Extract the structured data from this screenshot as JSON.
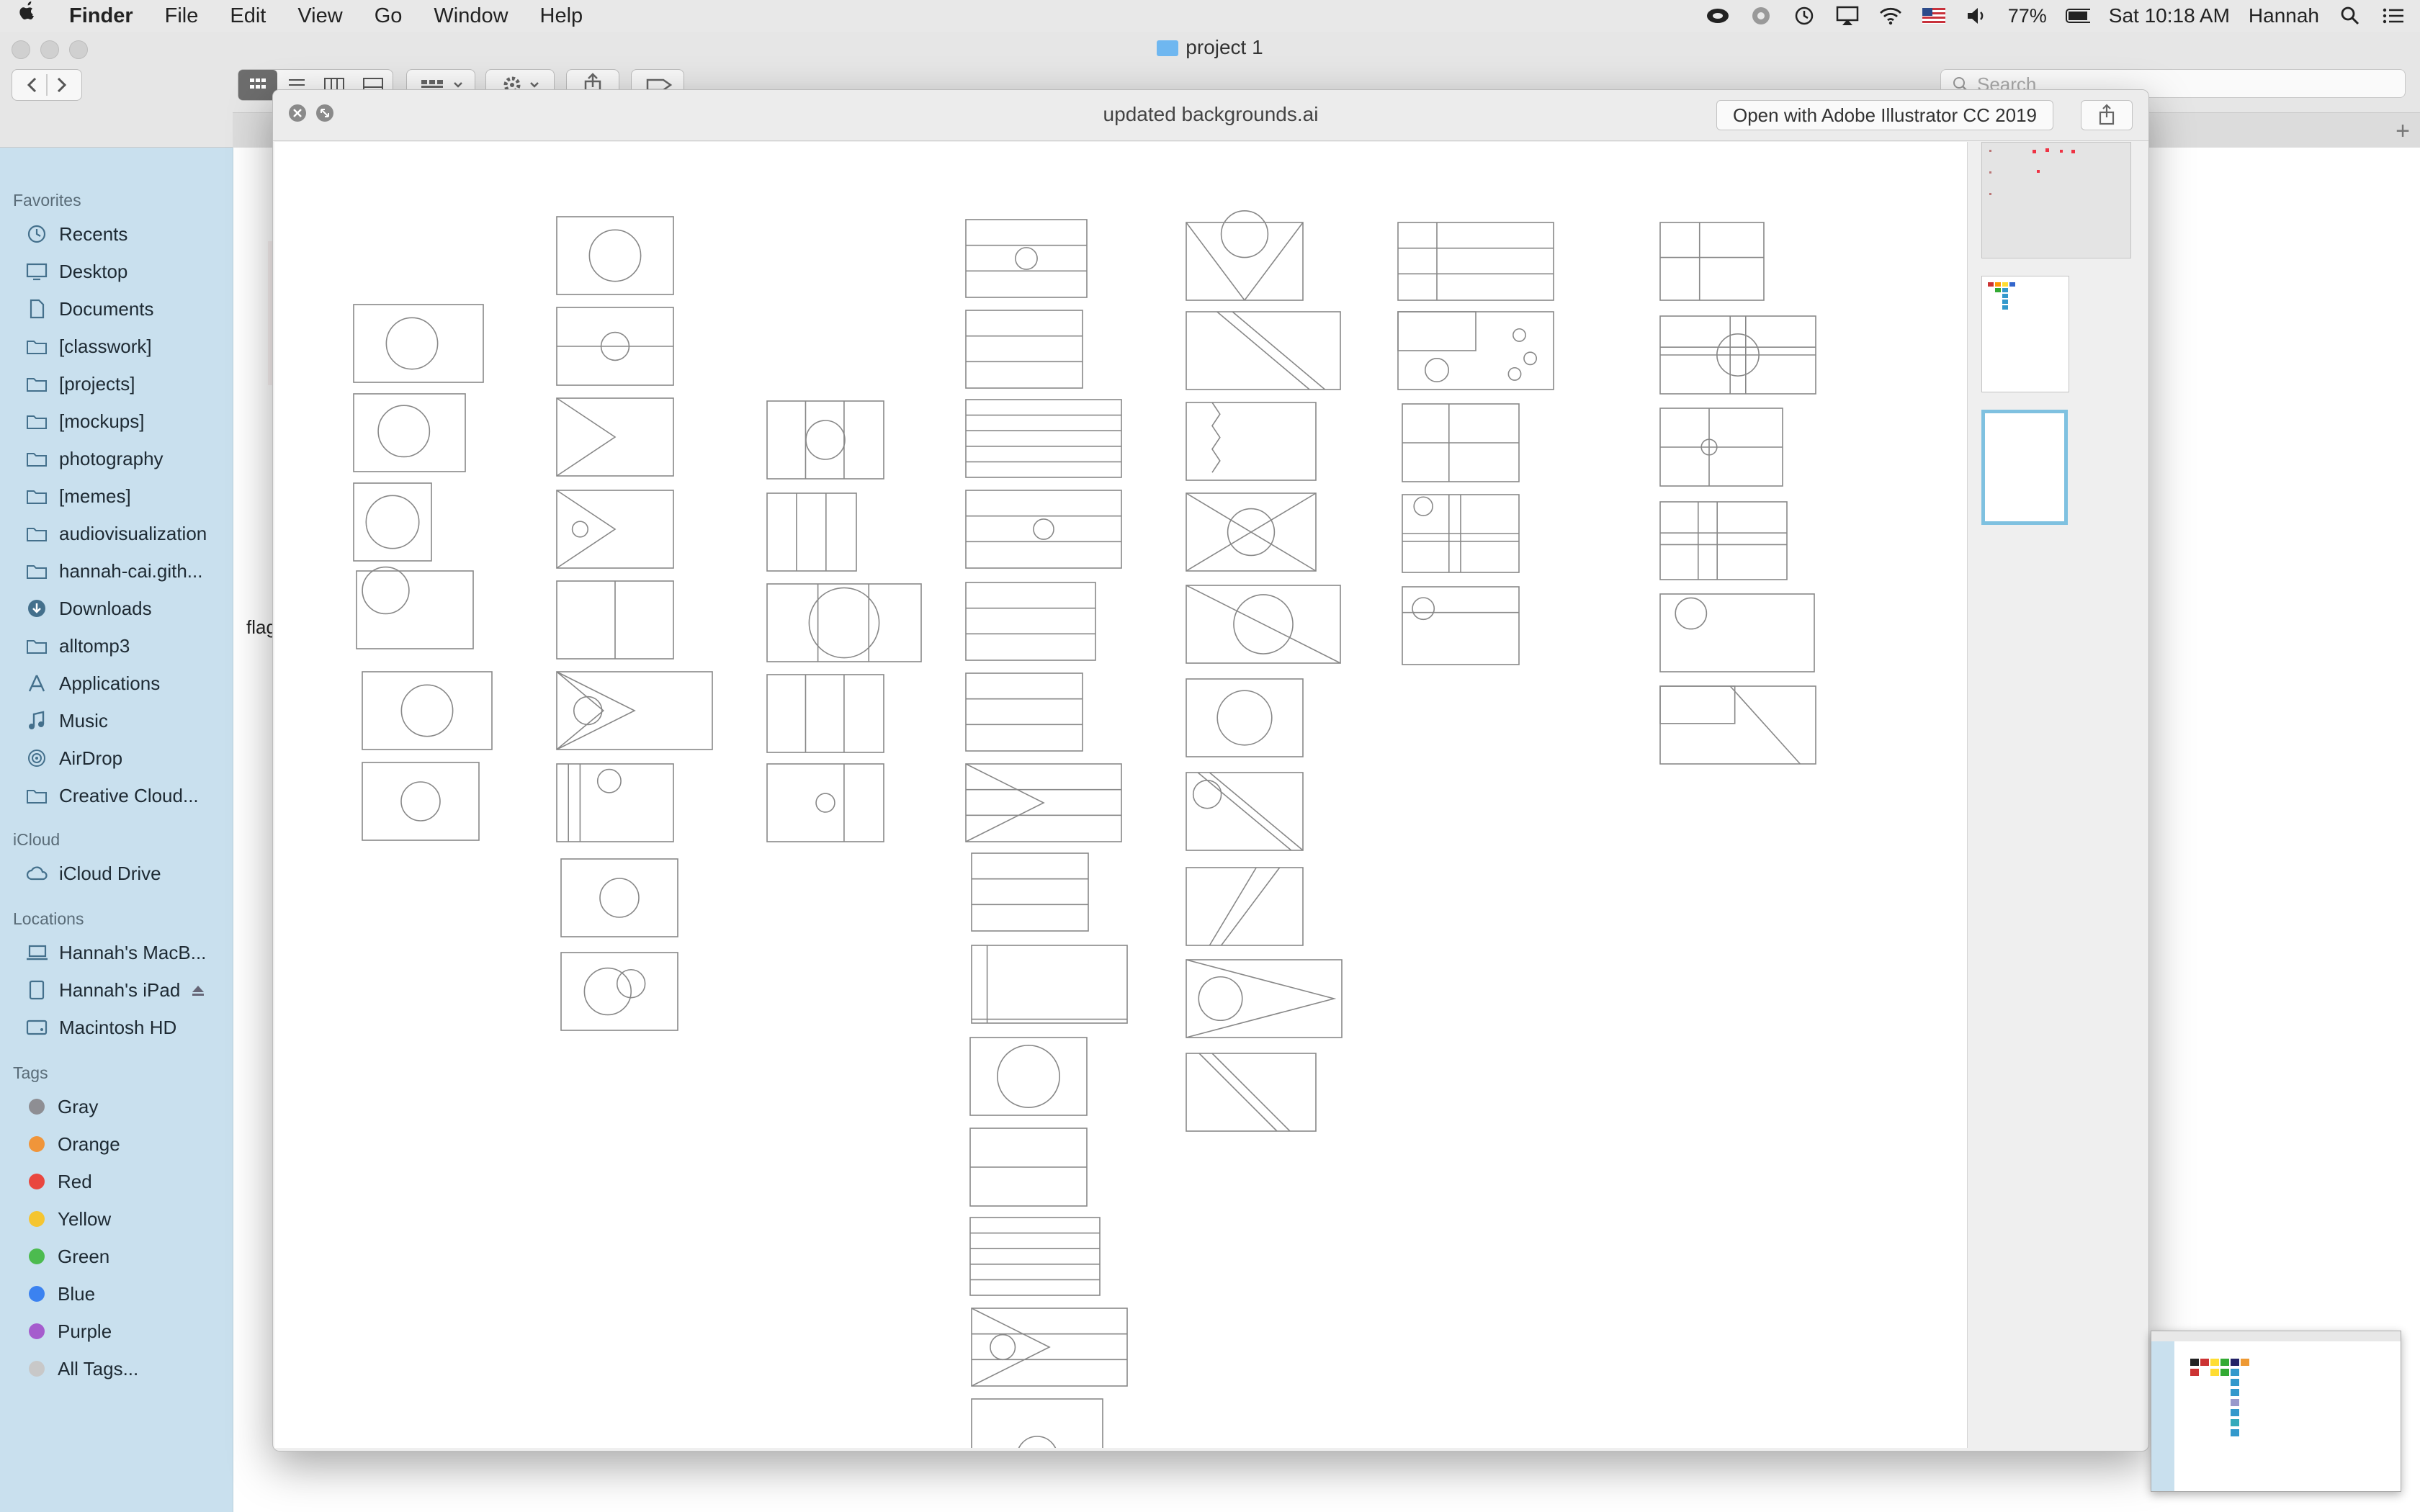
{
  "menubar": {
    "app": "Finder",
    "items": [
      "File",
      "Edit",
      "View",
      "Go",
      "Window",
      "Help"
    ],
    "battery": "77%",
    "clock": "Sat 10:18 AM",
    "user": "Hannah",
    "icons": [
      "apple-icon",
      "creative-cloud-icon",
      "sync-icon",
      "time-machine-icon",
      "airplay-icon",
      "wifi-icon",
      "us-flag-icon",
      "volume-icon",
      "battery-icon",
      "spotlight-icon",
      "notification-icon"
    ]
  },
  "finder": {
    "title": "project 1",
    "search_placeholder": "Search",
    "partial_label": "flag"
  },
  "sidebar": {
    "favorites_header": "Favorites",
    "favorites": [
      {
        "label": "Recents",
        "icon": "clock-icon"
      },
      {
        "label": "Desktop",
        "icon": "desktop-icon"
      },
      {
        "label": "Documents",
        "icon": "document-icon"
      },
      {
        "label": "[classwork]",
        "icon": "folder-icon"
      },
      {
        "label": "[projects]",
        "icon": "folder-icon"
      },
      {
        "label": "[mockups]",
        "icon": "folder-icon"
      },
      {
        "label": "photography",
        "icon": "folder-icon"
      },
      {
        "label": "[memes]",
        "icon": "folder-icon"
      },
      {
        "label": "audiovisualization",
        "icon": "folder-icon"
      },
      {
        "label": "hannah-cai.gith...",
        "icon": "folder-icon"
      },
      {
        "label": "Downloads",
        "icon": "download-icon"
      },
      {
        "label": "alltomp3",
        "icon": "folder-icon"
      },
      {
        "label": "Applications",
        "icon": "applications-icon"
      },
      {
        "label": "Music",
        "icon": "music-icon"
      },
      {
        "label": "AirDrop",
        "icon": "airdrop-icon"
      },
      {
        "label": "Creative Cloud...",
        "icon": "folder-icon"
      }
    ],
    "icloud_header": "iCloud",
    "icloud": [
      {
        "label": "iCloud Drive",
        "icon": "cloud-icon"
      }
    ],
    "locations_header": "Locations",
    "locations": [
      {
        "label": "Hannah's MacB...",
        "icon": "laptop-icon"
      },
      {
        "label": "Hannah's iPad",
        "icon": "ipad-icon"
      },
      {
        "label": "Macintosh HD",
        "icon": "disk-icon"
      }
    ],
    "tags_header": "Tags",
    "tags": [
      {
        "label": "Gray",
        "color": "#8e8e93"
      },
      {
        "label": "Orange",
        "color": "#f0953a"
      },
      {
        "label": "Red",
        "color": "#e9473f"
      },
      {
        "label": "Yellow",
        "color": "#f5c531"
      },
      {
        "label": "Green",
        "color": "#4cbb4f"
      },
      {
        "label": "Blue",
        "color": "#3b82f0"
      },
      {
        "label": "Purple",
        "color": "#a55ccd"
      },
      {
        "label": "All Tags...",
        "color": "#c8c8c8"
      }
    ]
  },
  "quicklook": {
    "title": "updated backgrounds.ai",
    "open_with": "Open with Adobe Illustrator CC 2019"
  }
}
